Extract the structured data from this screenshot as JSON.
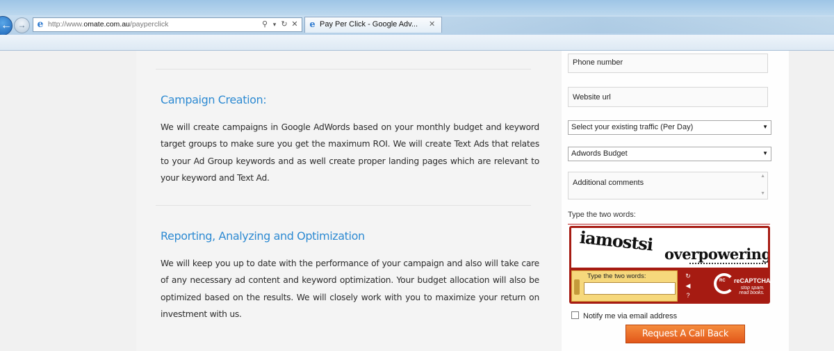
{
  "browser": {
    "address": {
      "prefix": "http://www.",
      "host": "omate.com.au",
      "path": "/payperclick"
    },
    "tab": {
      "title": "Pay Per Click - Google Adv..."
    },
    "icons": {
      "back": "back-arrow-icon",
      "forward": "forward-arrow-icon",
      "search": "search-icon",
      "refresh": "refresh-icon",
      "stop": "close-icon"
    },
    "glyphs": {
      "back": "←",
      "forward": "→",
      "ie": "e",
      "search": "⚲",
      "dropdown": "▾",
      "refresh": "↻",
      "stop": "✕",
      "tab_close": "✕"
    }
  },
  "main": {
    "sections": [
      {
        "heading": "Campaign Creation:",
        "body": "We will create campaigns in Google AdWords based on your monthly budget and keyword target groups to make sure you get the maximum ROI. We will create Text Ads that relates to your Ad Group keywords and as well create proper landing pages which are relevant to your keyword and Text Ad."
      },
      {
        "heading": "Reporting, Analyzing and Optimization",
        "body": "We will keep you up to date with the performance of your campaign and also will take care of any necessary ad content and keyword optimization. Your budget allocation will also be optimized based on the results. We will closely work with you to maximize your return on investment with us."
      }
    ]
  },
  "form": {
    "phone_placeholder": "Phone number",
    "website_placeholder": "Website url",
    "traffic_select": "Select your existing traffic (Per Day)",
    "budget_select": "Adwords Budget",
    "comments_placeholder": "Additional comments",
    "captcha_label": "Type the two words:",
    "notify_label": "Notify me via email address",
    "submit_label": "Request A Call Back"
  },
  "captcha": {
    "word1": "iamostsi",
    "word2": "overpowering",
    "input_label": "Type the two words:",
    "brand": "reCAPTCHA",
    "brand_short": "RC",
    "tagline_line1": "stop spam.",
    "tagline_line2": "read books.",
    "buttons": [
      "refresh-icon",
      "audio-icon",
      "help-icon"
    ],
    "button_glyphs": [
      "↻",
      "◀",
      "?"
    ]
  },
  "colors": {
    "heading": "#2d8ad2",
    "submit": "#e8641f",
    "captcha": "#a61b12"
  }
}
